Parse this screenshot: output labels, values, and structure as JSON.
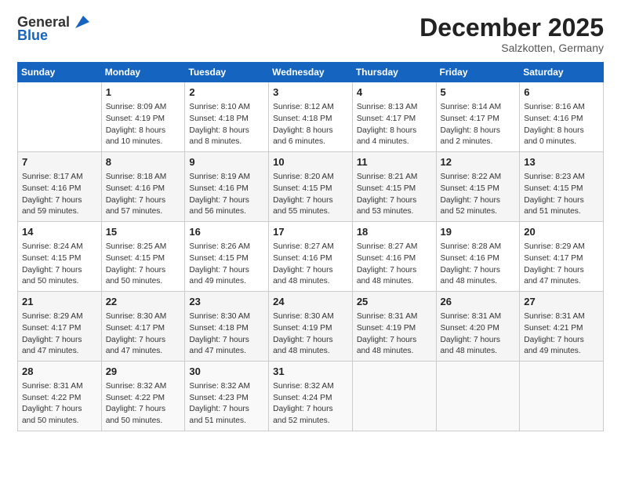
{
  "logo": {
    "line1": "General",
    "line2": "Blue"
  },
  "header": {
    "month": "December 2025",
    "location": "Salzkotten, Germany"
  },
  "weekdays": [
    "Sunday",
    "Monday",
    "Tuesday",
    "Wednesday",
    "Thursday",
    "Friday",
    "Saturday"
  ],
  "weeks": [
    [
      {
        "day": "",
        "data": ""
      },
      {
        "day": "1",
        "data": "Sunrise: 8:09 AM\nSunset: 4:19 PM\nDaylight: 8 hours\nand 10 minutes."
      },
      {
        "day": "2",
        "data": "Sunrise: 8:10 AM\nSunset: 4:18 PM\nDaylight: 8 hours\nand 8 minutes."
      },
      {
        "day": "3",
        "data": "Sunrise: 8:12 AM\nSunset: 4:18 PM\nDaylight: 8 hours\nand 6 minutes."
      },
      {
        "day": "4",
        "data": "Sunrise: 8:13 AM\nSunset: 4:17 PM\nDaylight: 8 hours\nand 4 minutes."
      },
      {
        "day": "5",
        "data": "Sunrise: 8:14 AM\nSunset: 4:17 PM\nDaylight: 8 hours\nand 2 minutes."
      },
      {
        "day": "6",
        "data": "Sunrise: 8:16 AM\nSunset: 4:16 PM\nDaylight: 8 hours\nand 0 minutes."
      }
    ],
    [
      {
        "day": "7",
        "data": "Sunrise: 8:17 AM\nSunset: 4:16 PM\nDaylight: 7 hours\nand 59 minutes."
      },
      {
        "day": "8",
        "data": "Sunrise: 8:18 AM\nSunset: 4:16 PM\nDaylight: 7 hours\nand 57 minutes."
      },
      {
        "day": "9",
        "data": "Sunrise: 8:19 AM\nSunset: 4:16 PM\nDaylight: 7 hours\nand 56 minutes."
      },
      {
        "day": "10",
        "data": "Sunrise: 8:20 AM\nSunset: 4:15 PM\nDaylight: 7 hours\nand 55 minutes."
      },
      {
        "day": "11",
        "data": "Sunrise: 8:21 AM\nSunset: 4:15 PM\nDaylight: 7 hours\nand 53 minutes."
      },
      {
        "day": "12",
        "data": "Sunrise: 8:22 AM\nSunset: 4:15 PM\nDaylight: 7 hours\nand 52 minutes."
      },
      {
        "day": "13",
        "data": "Sunrise: 8:23 AM\nSunset: 4:15 PM\nDaylight: 7 hours\nand 51 minutes."
      }
    ],
    [
      {
        "day": "14",
        "data": "Sunrise: 8:24 AM\nSunset: 4:15 PM\nDaylight: 7 hours\nand 50 minutes."
      },
      {
        "day": "15",
        "data": "Sunrise: 8:25 AM\nSunset: 4:15 PM\nDaylight: 7 hours\nand 50 minutes."
      },
      {
        "day": "16",
        "data": "Sunrise: 8:26 AM\nSunset: 4:15 PM\nDaylight: 7 hours\nand 49 minutes."
      },
      {
        "day": "17",
        "data": "Sunrise: 8:27 AM\nSunset: 4:16 PM\nDaylight: 7 hours\nand 48 minutes."
      },
      {
        "day": "18",
        "data": "Sunrise: 8:27 AM\nSunset: 4:16 PM\nDaylight: 7 hours\nand 48 minutes."
      },
      {
        "day": "19",
        "data": "Sunrise: 8:28 AM\nSunset: 4:16 PM\nDaylight: 7 hours\nand 48 minutes."
      },
      {
        "day": "20",
        "data": "Sunrise: 8:29 AM\nSunset: 4:17 PM\nDaylight: 7 hours\nand 47 minutes."
      }
    ],
    [
      {
        "day": "21",
        "data": "Sunrise: 8:29 AM\nSunset: 4:17 PM\nDaylight: 7 hours\nand 47 minutes."
      },
      {
        "day": "22",
        "data": "Sunrise: 8:30 AM\nSunset: 4:17 PM\nDaylight: 7 hours\nand 47 minutes."
      },
      {
        "day": "23",
        "data": "Sunrise: 8:30 AM\nSunset: 4:18 PM\nDaylight: 7 hours\nand 47 minutes."
      },
      {
        "day": "24",
        "data": "Sunrise: 8:30 AM\nSunset: 4:19 PM\nDaylight: 7 hours\nand 48 minutes."
      },
      {
        "day": "25",
        "data": "Sunrise: 8:31 AM\nSunset: 4:19 PM\nDaylight: 7 hours\nand 48 minutes."
      },
      {
        "day": "26",
        "data": "Sunrise: 8:31 AM\nSunset: 4:20 PM\nDaylight: 7 hours\nand 48 minutes."
      },
      {
        "day": "27",
        "data": "Sunrise: 8:31 AM\nSunset: 4:21 PM\nDaylight: 7 hours\nand 49 minutes."
      }
    ],
    [
      {
        "day": "28",
        "data": "Sunrise: 8:31 AM\nSunset: 4:22 PM\nDaylight: 7 hours\nand 50 minutes."
      },
      {
        "day": "29",
        "data": "Sunrise: 8:32 AM\nSunset: 4:22 PM\nDaylight: 7 hours\nand 50 minutes."
      },
      {
        "day": "30",
        "data": "Sunrise: 8:32 AM\nSunset: 4:23 PM\nDaylight: 7 hours\nand 51 minutes."
      },
      {
        "day": "31",
        "data": "Sunrise: 8:32 AM\nSunset: 4:24 PM\nDaylight: 7 hours\nand 52 minutes."
      },
      {
        "day": "",
        "data": ""
      },
      {
        "day": "",
        "data": ""
      },
      {
        "day": "",
        "data": ""
      }
    ]
  ]
}
